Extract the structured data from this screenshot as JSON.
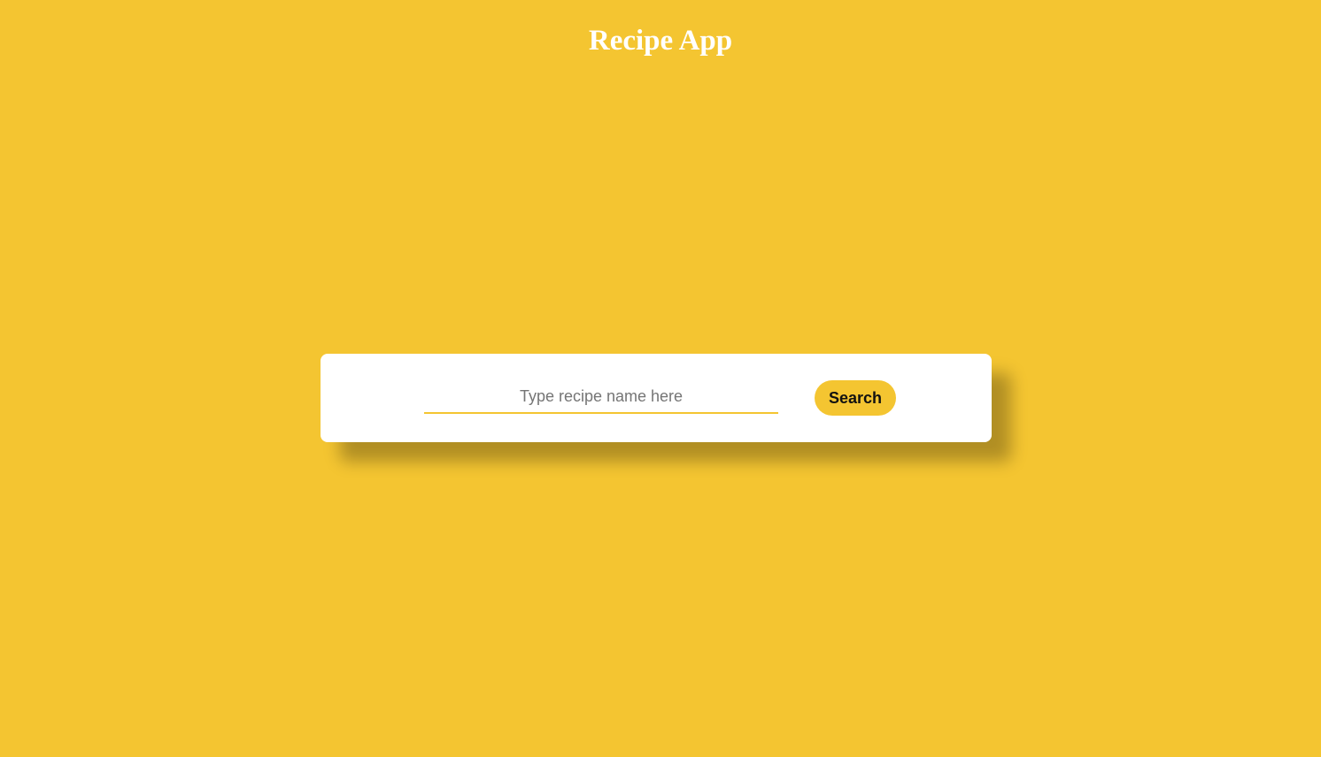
{
  "header": {
    "title": "Recipe App"
  },
  "search": {
    "placeholder": "Type recipe name here",
    "value": "",
    "button_label": "Search"
  },
  "colors": {
    "background": "#f4c531",
    "accent": "#f4c531",
    "card": "#ffffff",
    "title_text": "#ffffff"
  }
}
